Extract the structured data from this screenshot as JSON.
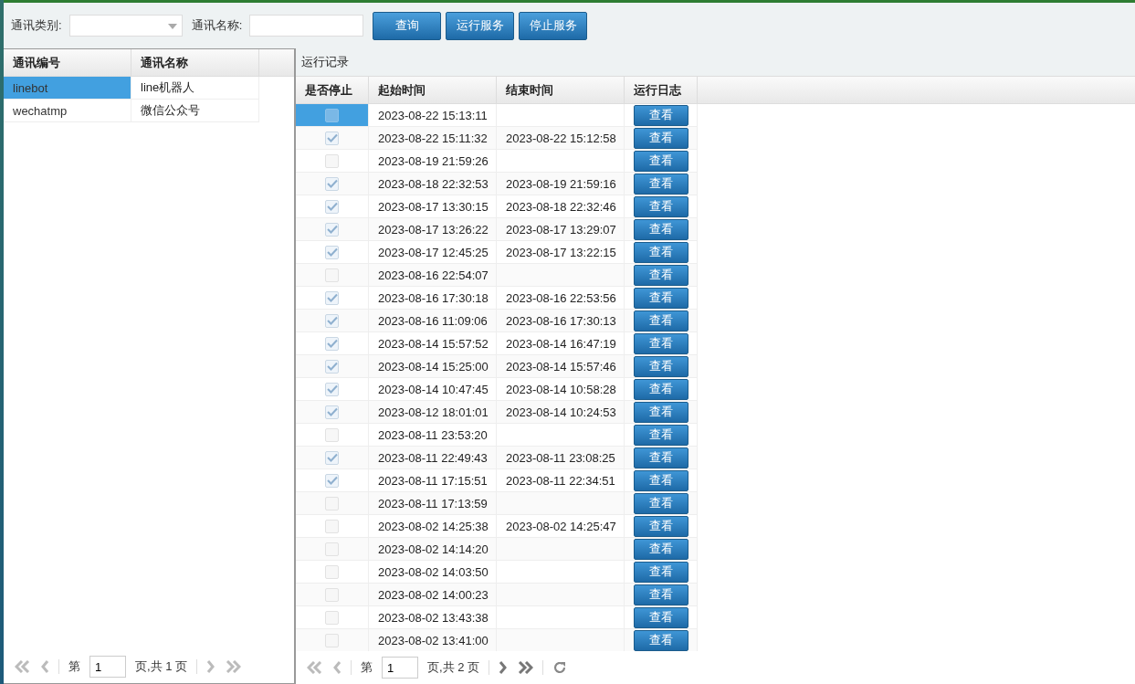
{
  "toolbar": {
    "category_label": "通讯类别:",
    "name_label": "通讯名称:",
    "buttons": [
      "查询",
      "运行服务",
      "停止服务"
    ]
  },
  "channels": {
    "columns": [
      "通讯编号",
      "通讯名称"
    ],
    "rows": [
      {
        "code": "linebot",
        "name": "line机器人",
        "selected": true
      },
      {
        "code": "wechatmp",
        "name": "微信公众号",
        "selected": false
      }
    ],
    "pager": {
      "before": "第",
      "page": "1",
      "after": "页,共 1 页"
    }
  },
  "records": {
    "title": "运行记录",
    "columns": [
      "是否停止",
      "起始时间",
      "结束时间",
      "运行日志"
    ],
    "rows": [
      {
        "stopped": false,
        "start": "2023-08-22 15:13:11",
        "selected": true,
        "log": "查看"
      },
      {
        "stopped": true,
        "start": "2023-08-22 15:11:32",
        "end": "2023-08-22 15:12:58",
        "selected": false,
        "log": "查看"
      },
      {
        "stopped": false,
        "start": "2023-08-19 21:59:26",
        "selected": false,
        "log": "查看"
      },
      {
        "stopped": true,
        "start": "2023-08-18 22:32:53",
        "end": "2023-08-19 21:59:16",
        "selected": false,
        "log": "查看"
      },
      {
        "stopped": true,
        "start": "2023-08-17 13:30:15",
        "end": "2023-08-18 22:32:46",
        "selected": false,
        "log": "查看"
      },
      {
        "stopped": true,
        "start": "2023-08-17 13:26:22",
        "end": "2023-08-17 13:29:07",
        "selected": false,
        "log": "查看"
      },
      {
        "stopped": true,
        "start": "2023-08-17 12:45:25",
        "end": "2023-08-17 13:22:15",
        "selected": false,
        "log": "查看"
      },
      {
        "stopped": false,
        "start": "2023-08-16 22:54:07",
        "selected": false,
        "log": "查看"
      },
      {
        "stopped": true,
        "start": "2023-08-16 17:30:18",
        "end": "2023-08-16 22:53:56",
        "selected": false,
        "log": "查看"
      },
      {
        "stopped": true,
        "start": "2023-08-16 11:09:06",
        "end": "2023-08-16 17:30:13",
        "selected": false,
        "log": "查看"
      },
      {
        "stopped": true,
        "start": "2023-08-14 15:57:52",
        "end": "2023-08-14 16:47:19",
        "selected": false,
        "log": "查看"
      },
      {
        "stopped": true,
        "start": "2023-08-14 15:25:00",
        "end": "2023-08-14 15:57:46",
        "selected": false,
        "log": "查看"
      },
      {
        "stopped": true,
        "start": "2023-08-14 10:47:45",
        "end": "2023-08-14 10:58:28",
        "selected": false,
        "log": "查看"
      },
      {
        "stopped": true,
        "start": "2023-08-12 18:01:01",
        "end": "2023-08-14 10:24:53",
        "selected": false,
        "log": "查看"
      },
      {
        "stopped": false,
        "start": "2023-08-11 23:53:20",
        "selected": false,
        "log": "查看"
      },
      {
        "stopped": true,
        "start": "2023-08-11 22:49:43",
        "end": "2023-08-11 23:08:25",
        "selected": false,
        "log": "查看"
      },
      {
        "stopped": true,
        "start": "2023-08-11 17:15:51",
        "end": "2023-08-11 22:34:51",
        "selected": false,
        "log": "查看"
      },
      {
        "stopped": false,
        "start": "2023-08-11 17:13:59",
        "selected": false,
        "log": "查看"
      },
      {
        "stopped": false,
        "start": "2023-08-02 14:25:38",
        "end": "2023-08-02 14:25:47",
        "selected": false,
        "log": "查看"
      },
      {
        "stopped": false,
        "start": "2023-08-02 14:14:20",
        "selected": false,
        "log": "查看"
      },
      {
        "stopped": false,
        "start": "2023-08-02 14:03:50",
        "selected": false,
        "log": "查看"
      },
      {
        "stopped": false,
        "start": "2023-08-02 14:00:23",
        "selected": false,
        "log": "查看"
      },
      {
        "stopped": false,
        "start": "2023-08-02 13:43:38",
        "selected": false,
        "log": "查看"
      },
      {
        "stopped": false,
        "start": "2023-08-02 13:41:00",
        "selected": false,
        "log": "查看"
      }
    ],
    "pager": {
      "before": "第",
      "page": "1",
      "after": "页,共 2 页"
    }
  }
}
